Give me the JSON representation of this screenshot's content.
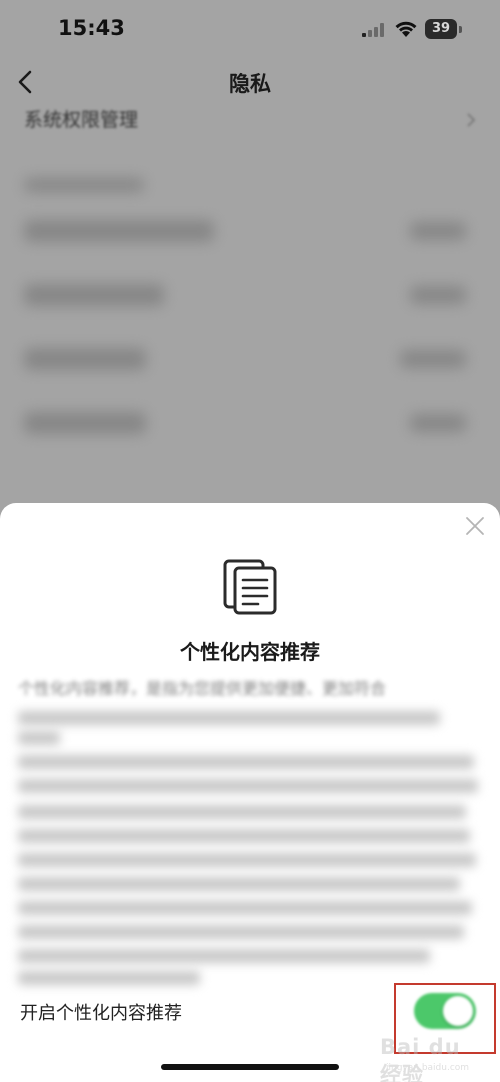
{
  "status_bar": {
    "time": "15:43",
    "battery": "39",
    "icons": [
      "signal-icon",
      "wifi-icon",
      "battery-icon"
    ]
  },
  "nav": {
    "title": "隐私",
    "back_icon": "chevron-left-icon"
  },
  "background_list": {
    "visible_item": "系统权限管理",
    "chevron_icon": "chevron-right-icon"
  },
  "sheet": {
    "close_icon": "close-icon",
    "header_icon": "document-icon",
    "title": "个性化内容推荐",
    "description_first_line": "个性化内容推荐，是指为您提供更加便捷、更加符合",
    "toggle_label": "开启个性化内容推荐",
    "toggle_on": true,
    "toggle_color": "#4cc86a"
  },
  "watermark": {
    "text": "Bai du 经验",
    "sub": "jingyan.baidu.com"
  },
  "colors": {
    "highlight": "#c43a2e",
    "overlay": "#a4a4a4"
  }
}
